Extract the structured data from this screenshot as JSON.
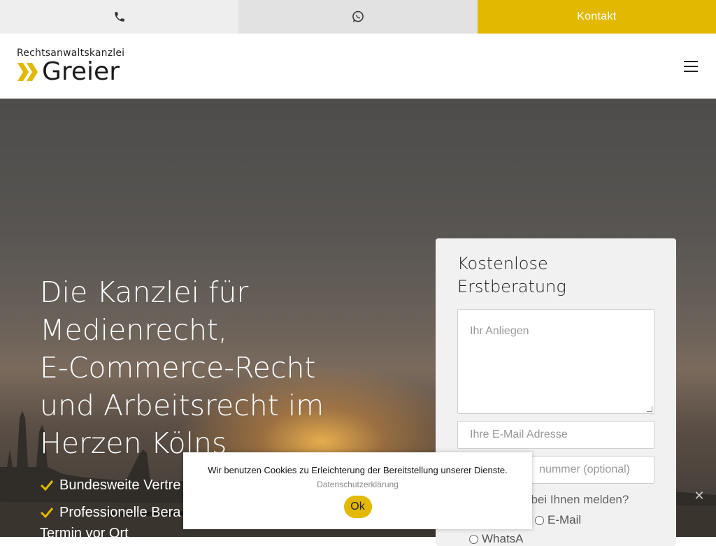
{
  "topbar": {
    "phone_icon": "phone-icon",
    "whatsapp_icon": "whatsapp-icon",
    "kontakt_label": "Kontakt"
  },
  "header": {
    "logo_small": "Rechtsanwaltskanzlei",
    "logo_big": "Greier",
    "menu_icon": "hamburger-menu-icon"
  },
  "hero": {
    "headline": [
      "Die Kanzlei für",
      "Medienrecht,",
      "E-Commerce-Recht",
      "und Arbeitsrecht im",
      "Herzen Kölns"
    ],
    "bullets": [
      "Bundesweite Vertre",
      "Professionelle Bera"
    ],
    "bullet_continuation": "Termin vor Ort"
  },
  "form": {
    "title_lines": [
      "Kostenlose",
      "Erstberatung"
    ],
    "anliegen_placeholder": "Ihr Anliegen",
    "email_placeholder": "Ihre E-Mail Adresse",
    "phone_placeholder_visible": "nummer (optional)",
    "question_visible": "ich bei Ihnen melden?",
    "radio_email": "E-Mail",
    "radio_whatsapp_visible": "WhatsA"
  },
  "cookie": {
    "text": "Wir benutzen Cookies zu Erleichterung der Bereitstellung unserer Dienste.",
    "link": "Datenschutzerklärung",
    "ok_label": "Ok"
  },
  "colors": {
    "accent": "#e2b800"
  }
}
